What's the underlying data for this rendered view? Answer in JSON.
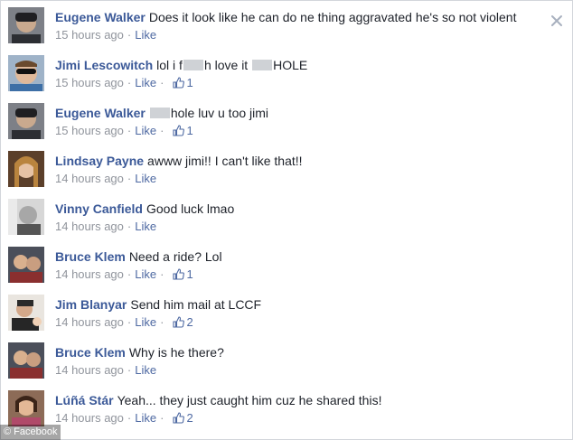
{
  "close_icon": "close-icon",
  "watermark": "© Facebook",
  "comments": [
    {
      "name": "Eugene Walker",
      "text": "Does it look like he can do ne thing aggravated he's so not violent",
      "time": "15 hours ago",
      "like": "Like",
      "likes": ""
    },
    {
      "name": "Jimi Lescowitch",
      "text_a": "lol i f",
      "text_b": "h love it ",
      "text_c": "HOLE",
      "time": "15 hours ago",
      "like": "Like",
      "likes": "1"
    },
    {
      "name": "Eugene Walker",
      "text_a": "",
      "text_b": "hole luv u too jimi",
      "time": "15 hours ago",
      "like": "Like",
      "likes": "1"
    },
    {
      "name": "Lindsay Payne",
      "text": "awww jimi!! I can't like that!!",
      "time": "14 hours ago",
      "like": "Like",
      "likes": ""
    },
    {
      "name": "Vinny Canfield",
      "text": "Good luck lmao",
      "time": "14 hours ago",
      "like": "Like",
      "likes": ""
    },
    {
      "name": "Bruce Klem",
      "text": "Need a ride? Lol",
      "time": "14 hours ago",
      "like": "Like",
      "likes": "1"
    },
    {
      "name": "Jim Blanyar",
      "text": "Send him mail at LCCF",
      "time": "14 hours ago",
      "like": "Like",
      "likes": "2"
    },
    {
      "name": "Bruce Klem",
      "text": "Why is he there?",
      "time": "14 hours ago",
      "like": "Like",
      "likes": ""
    },
    {
      "name": "Lúñá Stár",
      "text": "Yeah... they just caught him cuz he shared this!",
      "time": "14 hours ago",
      "like": "Like",
      "likes": "2"
    }
  ],
  "colors": {
    "name": "#3b5998",
    "meta": "#90949c",
    "link": "#4e69a2"
  }
}
